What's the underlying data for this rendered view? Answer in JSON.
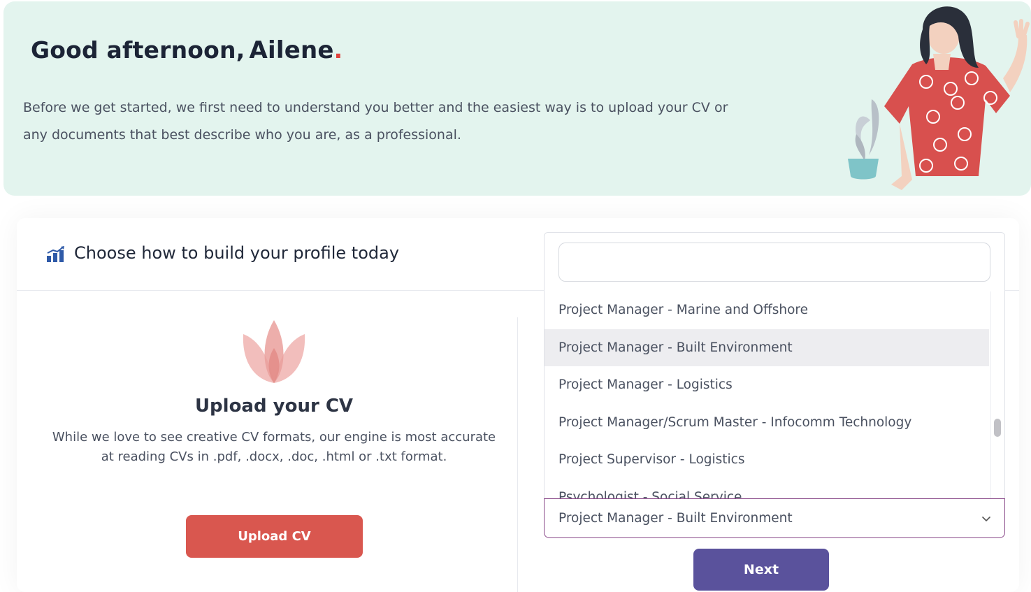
{
  "hero": {
    "greeting": "Good afternoon,",
    "user_name": "Ailene",
    "name_dot": ".",
    "intro_line1": "Before we get started, we first need to understand you better and the easiest way is to upload your CV or",
    "intro_line2": "any documents that best describe who you are, as a professional."
  },
  "card": {
    "title": "Choose how to build your profile today",
    "title_icon": "bar-chart-icon"
  },
  "upload": {
    "title": "Upload your CV",
    "description": "While we love to see creative CV formats, our engine is most accurate at reading CVs in .pdf, .docx, .doc, .html or .txt format.",
    "button_label": "Upload CV"
  },
  "dropdown": {
    "search_value": "",
    "items": [
      "Project Manager - Marine and Offshore",
      "Project Manager - Built Environment",
      "Project Manager - Logistics",
      "Project Manager/Scrum Master - Infocomm Technology",
      "Project Supervisor - Logistics",
      "Psychologist - Social Service"
    ],
    "highlighted_item": "Project Manager - Built Environment",
    "selected_value": "Project Manager - Built Environment"
  },
  "next_button_label": "Next",
  "colors": {
    "hero_bg": "#e3f4ee",
    "upload_button": "#d9574f",
    "next_button": "#5a529c",
    "select_border": "#8a4a8a",
    "name_dot": "#e0433e"
  }
}
